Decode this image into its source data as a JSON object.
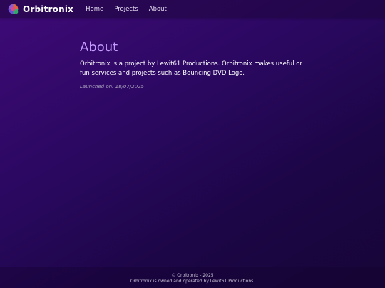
{
  "nav": {
    "brand": "Orbitronix",
    "links": [
      "Home",
      "Projects",
      "About"
    ]
  },
  "main": {
    "title": "About",
    "description": "Orbitronix is a project by Lewit61 Productions. Orbitronix makes useful or fun services and projects such as Bouncing DVD Logo.",
    "launched": "Launched on: 18/07/2025"
  },
  "footer": {
    "copyright": "© Orbitronix - 2025",
    "owner": "Orbitronix is owned and operated by Lewit61 Productions."
  },
  "colors": {
    "accent": "#c49bff",
    "background_dark": "#170537",
    "background_light": "#3f0a78"
  },
  "icons": {
    "logo": "orbitronix-logo-icon"
  }
}
